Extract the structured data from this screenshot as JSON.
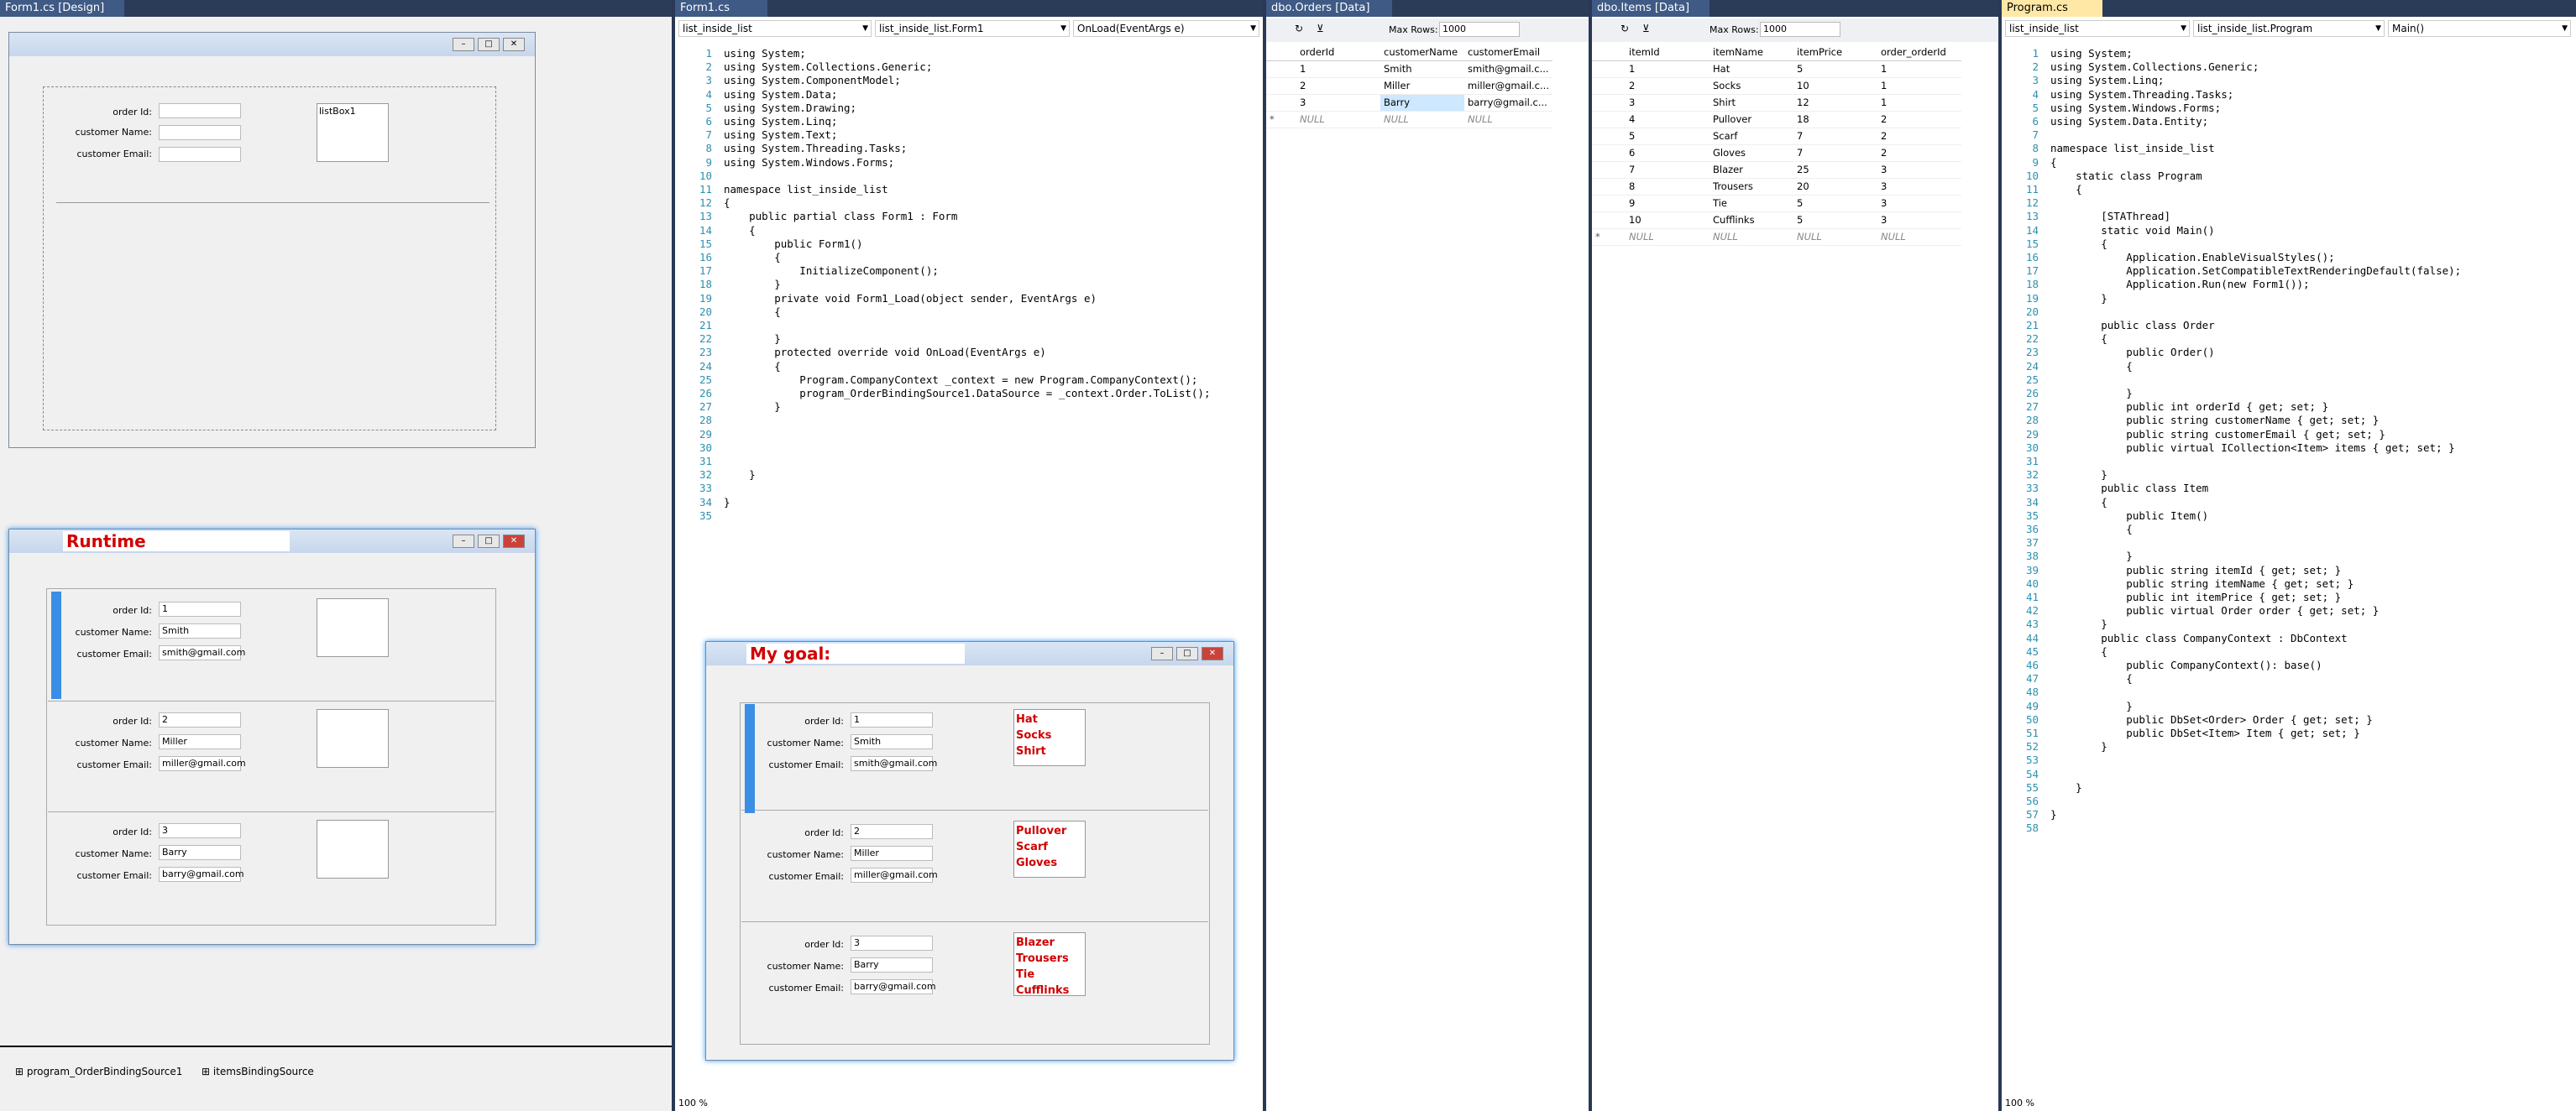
{
  "designer": {
    "tab": "Form1.cs [Design]",
    "listbox": "listBox1",
    "labels": {
      "order": "order Id:",
      "name": "customer Name:",
      "email": "customer Email:"
    },
    "runtime_title": "Runtime",
    "goal_title": "My goal:",
    "components": [
      "program_OrderBindingSource1",
      "itemsBindingSource"
    ],
    "rows": [
      {
        "id": "1",
        "name": "Smith",
        "email": "smith@gmail.com"
      },
      {
        "id": "2",
        "name": "Miller",
        "email": "miller@gmail.com"
      },
      {
        "id": "3",
        "name": "Barry",
        "email": "barry@gmail.com"
      }
    ],
    "goal_items": [
      [
        "Hat",
        "Socks",
        "Shirt"
      ],
      [
        "Pullover",
        "Scarf",
        "Gloves"
      ],
      [
        "Blazer",
        "Trousers",
        "Tie",
        "Cufflinks"
      ]
    ]
  },
  "form1": {
    "tab": "Form1.cs",
    "dd1": "list_inside_list",
    "dd2": "list_inside_list.Form1",
    "dd3": "OnLoad(EventArgs e)",
    "zoom": "100 %",
    "lines": [
      "using System;",
      "using System.Collections.Generic;",
      "using System.ComponentModel;",
      "using System.Data;",
      "using System.Drawing;",
      "using System.Linq;",
      "using System.Text;",
      "using System.Threading.Tasks;",
      "using System.Windows.Forms;",
      "",
      "namespace list_inside_list",
      "{",
      "    public partial class Form1 : Form",
      "    {",
      "        public Form1()",
      "        {",
      "            InitializeComponent();",
      "        }",
      "        private void Form1_Load(object sender, EventArgs e)",
      "        {",
      "",
      "        }",
      "        protected override void OnLoad(EventArgs e)",
      "        {",
      "            Program.CompanyContext _context = new Program.CompanyContext();",
      "            program_OrderBindingSource1.DataSource = _context.Order.ToList();",
      "        }",
      "",
      "",
      "",
      "",
      "    }",
      "",
      "}",
      ""
    ]
  },
  "orders": {
    "tab": "dbo.Orders [Data]",
    "maxrows_label": "Max Rows:",
    "maxrows": "1000",
    "cols": [
      "orderId",
      "customerName",
      "customerEmail"
    ],
    "rows": [
      [
        "1",
        "Smith",
        "smith@gmail.c..."
      ],
      [
        "2",
        "Miller",
        "miller@gmail.c..."
      ],
      [
        "3",
        "Barry",
        "barry@gmail.c..."
      ],
      [
        "NULL",
        "NULL",
        "NULL"
      ]
    ]
  },
  "items": {
    "tab": "dbo.Items [Data]",
    "maxrows_label": "Max Rows:",
    "maxrows": "1000",
    "cols": [
      "itemId",
      "itemName",
      "itemPrice",
      "order_orderId"
    ],
    "rows": [
      [
        "1",
        "Hat",
        "5",
        "1"
      ],
      [
        "2",
        "Socks",
        "10",
        "1"
      ],
      [
        "3",
        "Shirt",
        "12",
        "1"
      ],
      [
        "4",
        "Pullover",
        "18",
        "2"
      ],
      [
        "5",
        "Scarf",
        "7",
        "2"
      ],
      [
        "6",
        "Gloves",
        "7",
        "2"
      ],
      [
        "7",
        "Blazer",
        "25",
        "3"
      ],
      [
        "8",
        "Trousers",
        "20",
        "3"
      ],
      [
        "9",
        "Tie",
        "5",
        "3"
      ],
      [
        "10",
        "Cufflinks",
        "5",
        "3"
      ],
      [
        "NULL",
        "NULL",
        "NULL",
        "NULL"
      ]
    ]
  },
  "program": {
    "tab": "Program.cs",
    "dd1": "list_inside_list",
    "dd2": "list_inside_list.Program",
    "dd3": "Main()",
    "zoom": "100 %",
    "lines": [
      "using System;",
      "using System.Collections.Generic;",
      "using System.Linq;",
      "using System.Threading.Tasks;",
      "using System.Windows.Forms;",
      "using System.Data.Entity;",
      "",
      "namespace list_inside_list",
      "{",
      "    static class Program",
      "    {",
      "",
      "        [STAThread]",
      "        static void Main()",
      "        {",
      "            Application.EnableVisualStyles();",
      "            Application.SetCompatibleTextRenderingDefault(false);",
      "            Application.Run(new Form1());",
      "        }",
      "",
      "        public class Order",
      "        {",
      "            public Order()",
      "            {",
      "",
      "            }",
      "            public int orderId { get; set; }",
      "            public string customerName { get; set; }",
      "            public string customerEmail { get; set; }",
      "            public virtual ICollection<Item> items { get; set; }",
      "",
      "        }",
      "        public class Item",
      "        {",
      "            public Item()",
      "            {",
      "",
      "            }",
      "            public string itemId { get; set; }",
      "            public string itemName { get; set; }",
      "            public int itemPrice { get; set; }",
      "            public virtual Order order { get; set; }",
      "        }",
      "        public class CompanyContext : DbContext",
      "        {",
      "            public CompanyContext(): base()",
      "            {",
      "",
      "            }",
      "            public DbSet<Order> Order { get; set; }",
      "            public DbSet<Item> Item { get; set; }",
      "        }",
      "",
      "",
      "    }",
      "",
      "}",
      ""
    ]
  }
}
